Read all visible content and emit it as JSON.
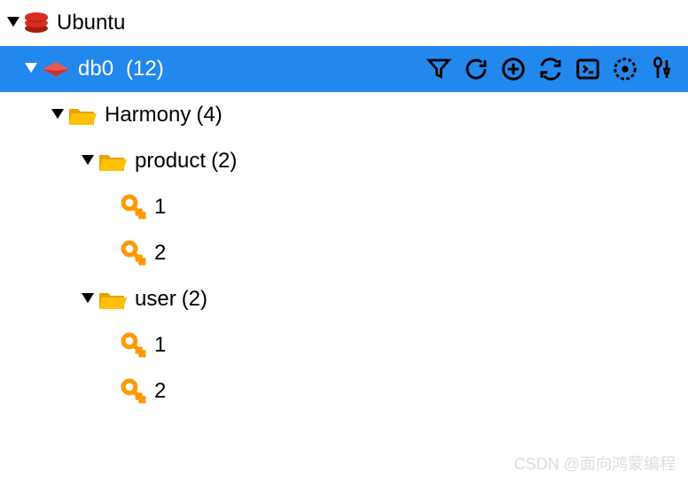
{
  "connection": {
    "name": "Ubuntu"
  },
  "database": {
    "name": "db0",
    "count": "(12)"
  },
  "tree": {
    "harmony": {
      "label": "Harmony",
      "count": "(4)"
    },
    "product": {
      "label": "product",
      "count": "(2)",
      "keys": [
        "1",
        "2"
      ]
    },
    "user": {
      "label": "user",
      "count": "(2)",
      "keys": [
        "1",
        "2"
      ]
    }
  },
  "toolbar_icons": {
    "filter": "filter-icon",
    "refresh": "refresh-icon",
    "add": "add-icon",
    "sync": "sync-icon",
    "console": "console-icon",
    "analyze": "analyze-icon",
    "tools": "tools-icon"
  },
  "watermark": "CSDN @面向鸿蒙编程"
}
